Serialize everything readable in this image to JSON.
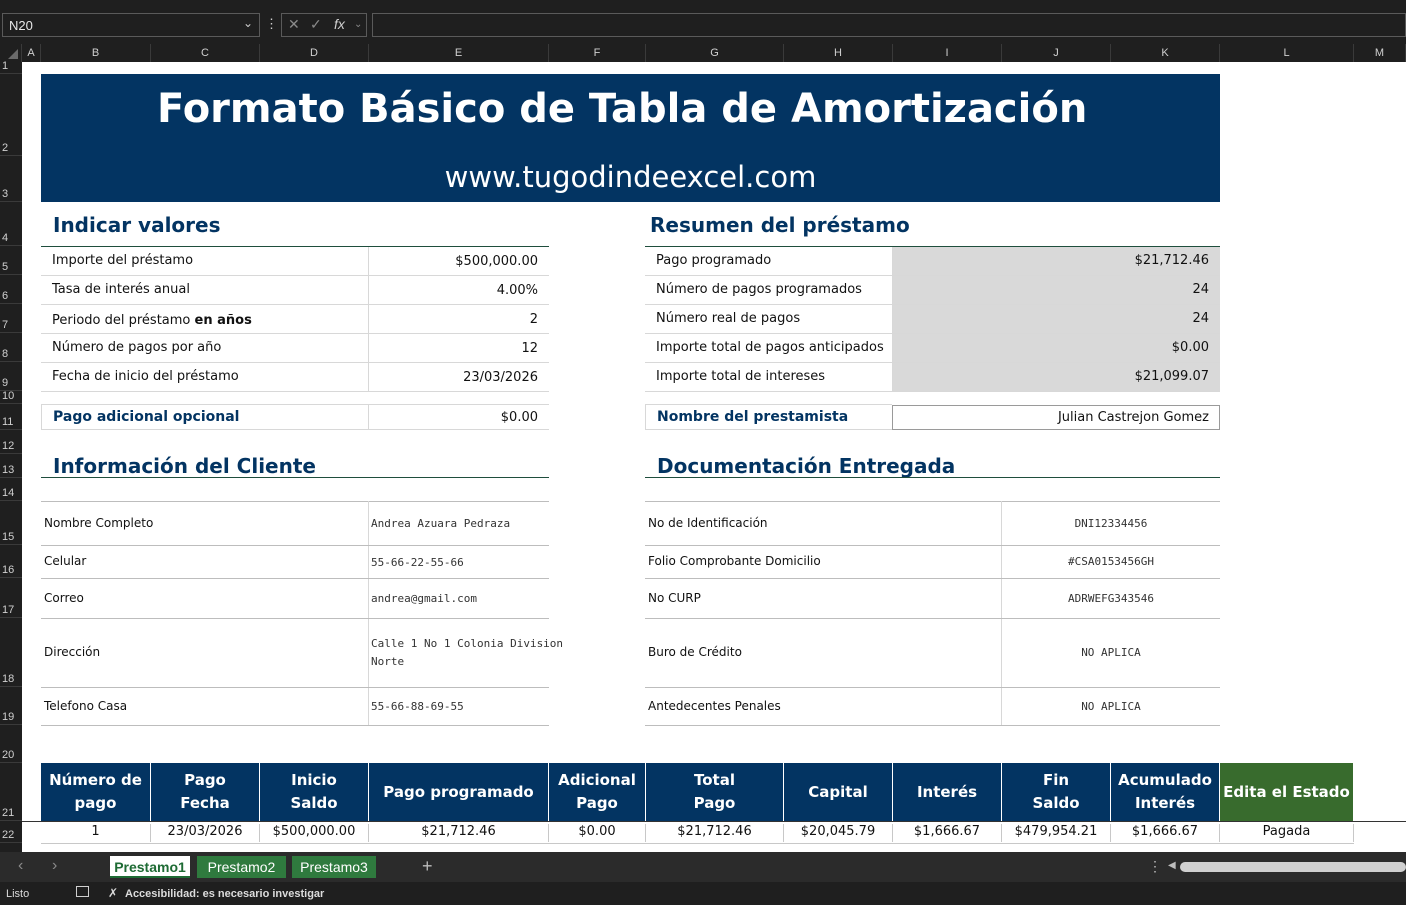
{
  "formula_bar": {
    "name_box": "N20",
    "fx_label": "fx"
  },
  "columns": [
    "A",
    "B",
    "C",
    "D",
    "E",
    "F",
    "G",
    "H",
    "I",
    "J",
    "K",
    "L",
    "M"
  ],
  "rows": [
    "1",
    "2",
    "3",
    "4",
    "5",
    "6",
    "7",
    "8",
    "9",
    "10",
    "11",
    "12",
    "13",
    "14",
    "15",
    "16",
    "17",
    "18",
    "19",
    "20",
    "21",
    "22"
  ],
  "banner": {
    "title": "Formato Básico de Tabla de Amortización",
    "url": "www.tugodindeexcel.com"
  },
  "inputs": {
    "title": "Indicar valores",
    "rows": [
      {
        "label_a": "Importe del préstamo",
        "label_b": "",
        "value": "$500,000.00"
      },
      {
        "label_a": "Tasa de interés anual",
        "label_b": "",
        "value": "4.00%"
      },
      {
        "label_a": "Periodo del préstamo ",
        "label_b": "en años",
        "value": "2"
      },
      {
        "label_a": "Número de pagos por año",
        "label_b": "",
        "value": "12"
      },
      {
        "label_a": "Fecha de inicio del préstamo",
        "label_b": "",
        "value": "23/03/2026"
      }
    ],
    "extra_label": "Pago adicional opcional",
    "extra_value": "$0.00"
  },
  "summary": {
    "title": "Resumen del préstamo",
    "rows": [
      {
        "label": "Pago programado",
        "value": "$21,712.46"
      },
      {
        "label": "Número de pagos programados",
        "value": "24"
      },
      {
        "label": "Número real de pagos",
        "value": "24"
      },
      {
        "label": "Importe total de pagos anticipados",
        "value": "$0.00"
      },
      {
        "label": "Importe total de intereses",
        "value": "$21,099.07"
      }
    ],
    "lender_label": "Nombre del prestamista",
    "lender_value": "Julian Castrejon Gomez"
  },
  "client": {
    "title": "Información del Cliente",
    "rows": [
      {
        "label": "Nombre Completo",
        "value": "Andrea Azuara Pedraza"
      },
      {
        "label": "Celular",
        "value": "55-66-22-55-66"
      },
      {
        "label": "Correo",
        "value": "andrea@gmail.com"
      },
      {
        "label": "Dirección",
        "value": "Calle 1 No 1 Colonia Division",
        "value2": "Norte"
      },
      {
        "label": "Telefono Casa",
        "value": "55-66-88-69-55"
      }
    ]
  },
  "docs": {
    "title": "Documentación Entregada",
    "rows": [
      {
        "label": "No de Identificación",
        "value": "DNI12334456"
      },
      {
        "label": "Folio Comprobante Domicilio",
        "value": "#CSA0153456GH"
      },
      {
        "label": "No CURP",
        "value": "ADRWEFG343546"
      },
      {
        "label": "Buro de Crédito",
        "value": "NO APLICA"
      },
      {
        "label": "Antedecentes Penales",
        "value": "NO APLICA"
      }
    ]
  },
  "table": {
    "headers": [
      {
        "l1": "Número de",
        "l2": "pago"
      },
      {
        "l1": "Pago",
        "l2": "Fecha"
      },
      {
        "l1": "Inicio",
        "l2": "Saldo"
      },
      {
        "l1": "Pago programado",
        "l2": ""
      },
      {
        "l1": "Adicional",
        "l2": "Pago"
      },
      {
        "l1": "Total",
        "l2": "Pago"
      },
      {
        "l1": "Capital",
        "l2": ""
      },
      {
        "l1": "Interés",
        "l2": ""
      },
      {
        "l1": "Fin",
        "l2": "Saldo"
      },
      {
        "l1": "Acumulado",
        "l2": "Interés"
      },
      {
        "l1": "Edita el Estado",
        "l2": ""
      }
    ],
    "row1": [
      "1",
      "23/03/2026",
      "$500,000.00",
      "$21,712.46",
      "$0.00",
      "$21,712.46",
      "$20,045.79",
      "$1,666.67",
      "$479,954.21",
      "$1,666.67",
      "Pagada"
    ],
    "edit_color": "#386b2d",
    "header_color": "#033462"
  },
  "sheet_tabs": [
    "Prestamo1",
    "Prestamo2",
    "Prestamo3"
  ],
  "status": {
    "ready": "Listo",
    "accessibility": "Accesibilidad: es necesario investigar"
  }
}
